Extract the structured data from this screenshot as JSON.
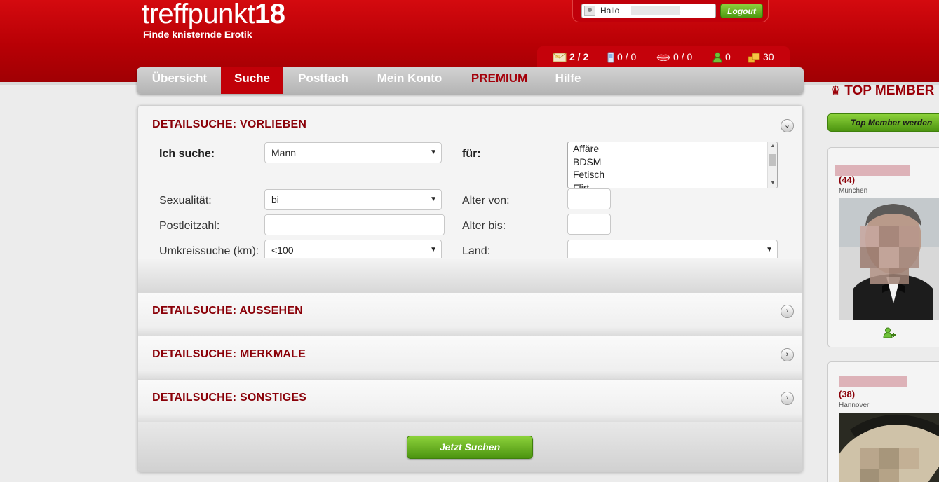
{
  "header": {
    "logo_text": "treffpunkt",
    "logo_number": "18",
    "slogan": "Finde knisternde Erotik",
    "hello_label": "Hallo",
    "logout_label": "Logout",
    "stats": [
      {
        "icon": "mail-icon",
        "value": "2 / 2"
      },
      {
        "icon": "phone-icon",
        "value": "0 / 0"
      },
      {
        "icon": "kiss-icon",
        "value": "0 / 0"
      },
      {
        "icon": "user-icon",
        "value": "0"
      },
      {
        "icon": "coins-icon",
        "value": "30"
      }
    ]
  },
  "nav": {
    "items": [
      {
        "label": "Übersicht"
      },
      {
        "label": "Suche"
      },
      {
        "label": "Postfach"
      },
      {
        "label": "Mein Konto"
      },
      {
        "label": "PREMIUM"
      },
      {
        "label": "Hilfe"
      }
    ],
    "active": "Suche"
  },
  "search": {
    "vorlieben": {
      "title": "DETAILSUCHE: VORLIEBEN",
      "ich_suche_label": "Ich suche:",
      "ich_suche_value": "Mann",
      "fuer_label": "für:",
      "fuer_options": [
        "Affäre",
        "BDSM",
        "Fetisch",
        "Flirt"
      ],
      "sexualitaet_label": "Sexualität:",
      "sexualitaet_value": "bi",
      "postleitzahl_label": "Postleitzahl:",
      "postleitzahl_value": "",
      "umkreis_label": "Umkreissuche (km):",
      "umkreis_value": "<100",
      "alter_von_label": "Alter von:",
      "alter_von_value": "",
      "alter_bis_label": "Alter bis:",
      "alter_bis_value": "",
      "land_label": "Land:",
      "land_value": ""
    },
    "aussehen_title": "DETAILSUCHE: AUSSEHEN",
    "merkmale_title": "DETAILSUCHE: MERKMALE",
    "sonstiges_title": "DETAILSUCHE: SONSTIGES",
    "submit_label": "Jetzt Suchen"
  },
  "sidebar": {
    "title": "TOP MEMBER",
    "become_top_label": "Top Member werden",
    "members": [
      {
        "age": "(44)",
        "city": "München"
      },
      {
        "age": "(38)",
        "city": "Hannover"
      }
    ]
  },
  "colors": {
    "brand_red": "#c10008",
    "dark_red_text": "#8a0008",
    "green_button": "#5aa81c"
  }
}
